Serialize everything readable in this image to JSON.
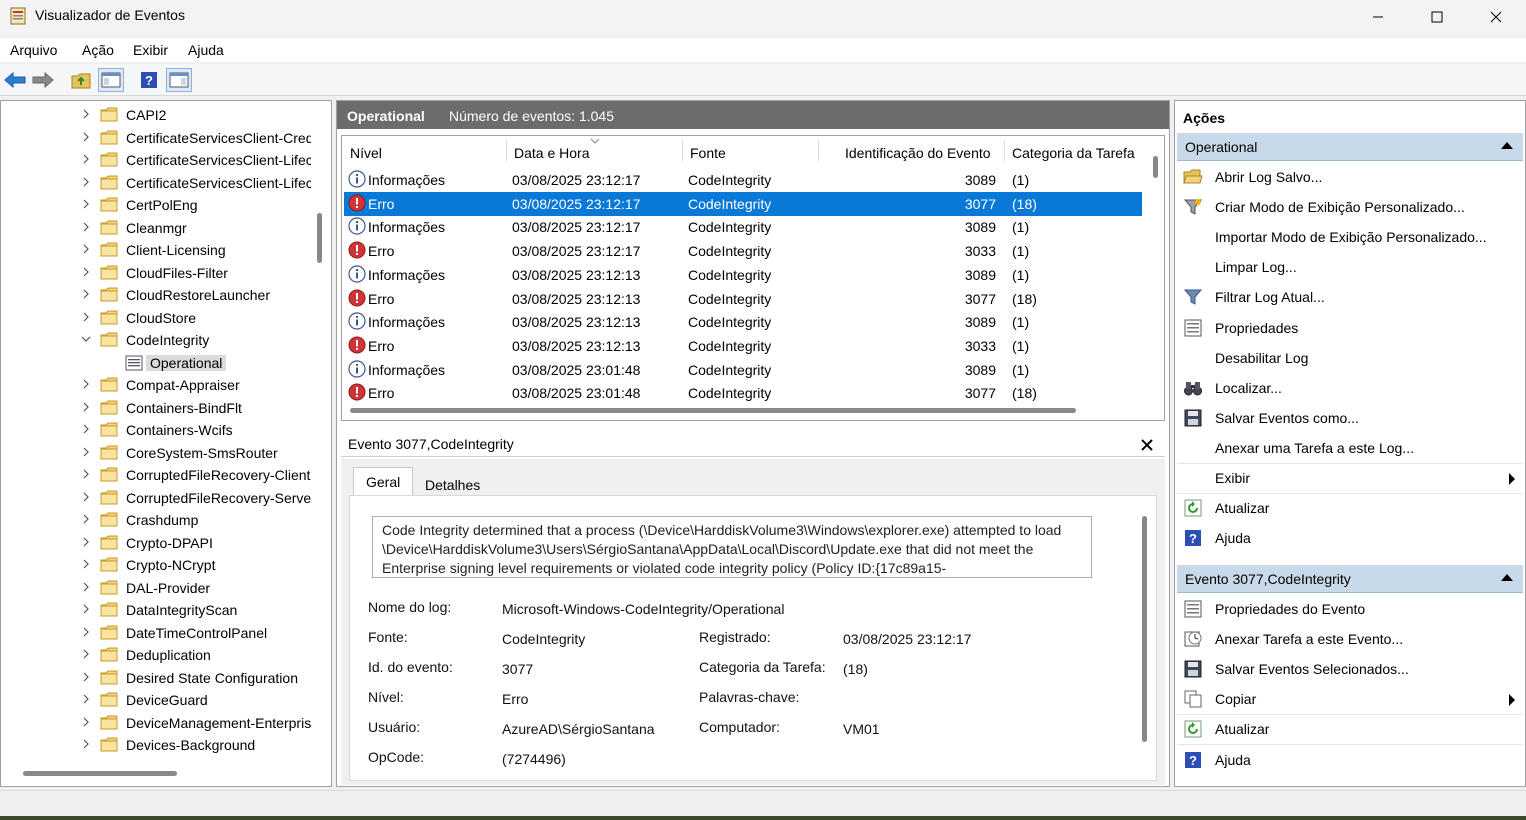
{
  "window": {
    "title": "Visualizador de Eventos"
  },
  "menu": [
    "Arquivo",
    "Ação",
    "Exibir",
    "Ajuda"
  ],
  "tree": {
    "items": [
      {
        "label": "CAPI2"
      },
      {
        "label": "CertificateServicesClient-CredentialRoaming"
      },
      {
        "label": "CertificateServicesClient-Lifecycle-System"
      },
      {
        "label": "CertificateServicesClient-Lifecycle-User"
      },
      {
        "label": "CertPolEng"
      },
      {
        "label": "Cleanmgr"
      },
      {
        "label": "Client-Licensing"
      },
      {
        "label": "CloudFiles-Filter"
      },
      {
        "label": "CloudRestoreLauncher"
      },
      {
        "label": "CloudStore"
      },
      {
        "label": "CodeIntegrity"
      },
      {
        "label": "Operational"
      },
      {
        "label": "Compat-Appraiser"
      },
      {
        "label": "Containers-BindFlt"
      },
      {
        "label": "Containers-Wcifs"
      },
      {
        "label": "CoreSystem-SmsRouter"
      },
      {
        "label": "CorruptedFileRecovery-Client"
      },
      {
        "label": "CorruptedFileRecovery-Server"
      },
      {
        "label": "Crashdump"
      },
      {
        "label": "Crypto-DPAPI"
      },
      {
        "label": "Crypto-NCrypt"
      },
      {
        "label": "DAL-Provider"
      },
      {
        "label": "DataIntegrityScan"
      },
      {
        "label": "DateTimeControlPanel"
      },
      {
        "label": "Deduplication"
      },
      {
        "label": "Desired State Configuration"
      },
      {
        "label": "DeviceGuard"
      },
      {
        "label": "DeviceManagement-Enterprise"
      },
      {
        "label": "Devices-Background"
      }
    ]
  },
  "log": {
    "name": "Operational",
    "count": "Número de eventos: 1.045",
    "columns": [
      "Nível",
      "Data e Hora",
      "Fonte",
      "Identificação do Evento",
      "Categoria da Tarefa"
    ],
    "rows": [
      {
        "level": "Informações",
        "type": "info",
        "date": "03/08/2025 23:12:17",
        "source": "CodeIntegrity",
        "id": "3089",
        "cat": "(1)"
      },
      {
        "level": "Erro",
        "type": "error",
        "date": "03/08/2025 23:12:17",
        "source": "CodeIntegrity",
        "id": "3077",
        "cat": "(18)"
      },
      {
        "level": "Informações",
        "type": "info",
        "date": "03/08/2025 23:12:17",
        "source": "CodeIntegrity",
        "id": "3089",
        "cat": "(1)"
      },
      {
        "level": "Erro",
        "type": "error",
        "date": "03/08/2025 23:12:17",
        "source": "CodeIntegrity",
        "id": "3033",
        "cat": "(1)"
      },
      {
        "level": "Informações",
        "type": "info",
        "date": "03/08/2025 23:12:13",
        "source": "CodeIntegrity",
        "id": "3089",
        "cat": "(1)"
      },
      {
        "level": "Erro",
        "type": "error",
        "date": "03/08/2025 23:12:13",
        "source": "CodeIntegrity",
        "id": "3077",
        "cat": "(18)"
      },
      {
        "level": "Informações",
        "type": "info",
        "date": "03/08/2025 23:12:13",
        "source": "CodeIntegrity",
        "id": "3089",
        "cat": "(1)"
      },
      {
        "level": "Erro",
        "type": "error",
        "date": "03/08/2025 23:12:13",
        "source": "CodeIntegrity",
        "id": "3033",
        "cat": "(1)"
      },
      {
        "level": "Informações",
        "type": "info",
        "date": "03/08/2025 23:01:48",
        "source": "CodeIntegrity",
        "id": "3089",
        "cat": "(1)"
      },
      {
        "level": "Erro",
        "type": "error",
        "date": "03/08/2025 23:01:48",
        "source": "CodeIntegrity",
        "id": "3077",
        "cat": "(18)"
      }
    ]
  },
  "detail": {
    "title": "Evento 3077,CodeIntegrity",
    "tabs": [
      "Geral",
      "Detalhes"
    ],
    "message": "Code Integrity determined that a process (\\Device\\HarddiskVolume3\\Windows\\explorer.exe) attempted to load \\Device\\HarddiskVolume3\\Users\\SérgioSantana\\AppData\\Local\\Discord\\Update.exe that did not meet the Enterprise signing level requirements or violated code integrity policy (Policy ID:{17c89a15-",
    "labels": {
      "log_name": "Nome do log:",
      "source": "Fonte:",
      "event_id": "Id. do evento:",
      "level": "Nível:",
      "user": "Usuário:",
      "opcode": "OpCode:",
      "logged": "Registrado:",
      "task_cat": "Categoria da Tarefa:",
      "keywords": "Palavras-chave:",
      "computer": "Computador:"
    },
    "values": {
      "log_name": "Microsoft-Windows-CodeIntegrity/Operational",
      "source": "CodeIntegrity",
      "event_id": "3077",
      "level": "Erro",
      "user": "AzureAD\\SérgioSantana",
      "opcode": "(7274496)",
      "logged": "03/08/2025 23:12:17",
      "task_cat": "(18)",
      "keywords": "",
      "computer": "VM01"
    }
  },
  "actions": {
    "title": "Ações",
    "section1": "Operational",
    "items1": [
      {
        "label": "Abrir Log Salvo...",
        "icon": "folder-open-icon"
      },
      {
        "label": "Criar Modo de Exibição Personalizado...",
        "icon": "filter-star-icon"
      },
      {
        "label": "Importar Modo de Exibição Personalizado...",
        "icon": ""
      },
      {
        "label": "Limpar Log...",
        "icon": ""
      },
      {
        "label": "Filtrar Log Atual...",
        "icon": "filter-icon"
      },
      {
        "label": "Propriedades",
        "icon": "properties-icon"
      },
      {
        "label": "Desabilitar Log",
        "icon": ""
      },
      {
        "label": "Localizar...",
        "icon": "binoculars-icon"
      },
      {
        "label": "Salvar Eventos como...",
        "icon": "save-icon"
      },
      {
        "label": "Anexar uma Tarefa a este Log...",
        "icon": ""
      },
      {
        "label": "Exibir",
        "icon": "",
        "submenu": true
      },
      {
        "label": "Atualizar",
        "icon": "refresh-icon"
      },
      {
        "label": "Ajuda",
        "icon": "help-icon"
      }
    ],
    "section2": "Evento 3077,CodeIntegrity",
    "items2": [
      {
        "label": "Propriedades do Evento",
        "icon": "properties-icon"
      },
      {
        "label": "Anexar Tarefa a este Evento...",
        "icon": "task-clock-icon"
      },
      {
        "label": "Salvar Eventos Selecionados...",
        "icon": "save-icon"
      },
      {
        "label": "Copiar",
        "icon": "copy-icon",
        "submenu": true
      },
      {
        "label": "Atualizar",
        "icon": "refresh-icon"
      },
      {
        "label": "Ajuda",
        "icon": "help-icon"
      }
    ]
  },
  "colors": {
    "selection": "#0a78d7",
    "section_header": "#c8d9ea",
    "log_header": "#6c6c6c",
    "error": "#d13438"
  }
}
